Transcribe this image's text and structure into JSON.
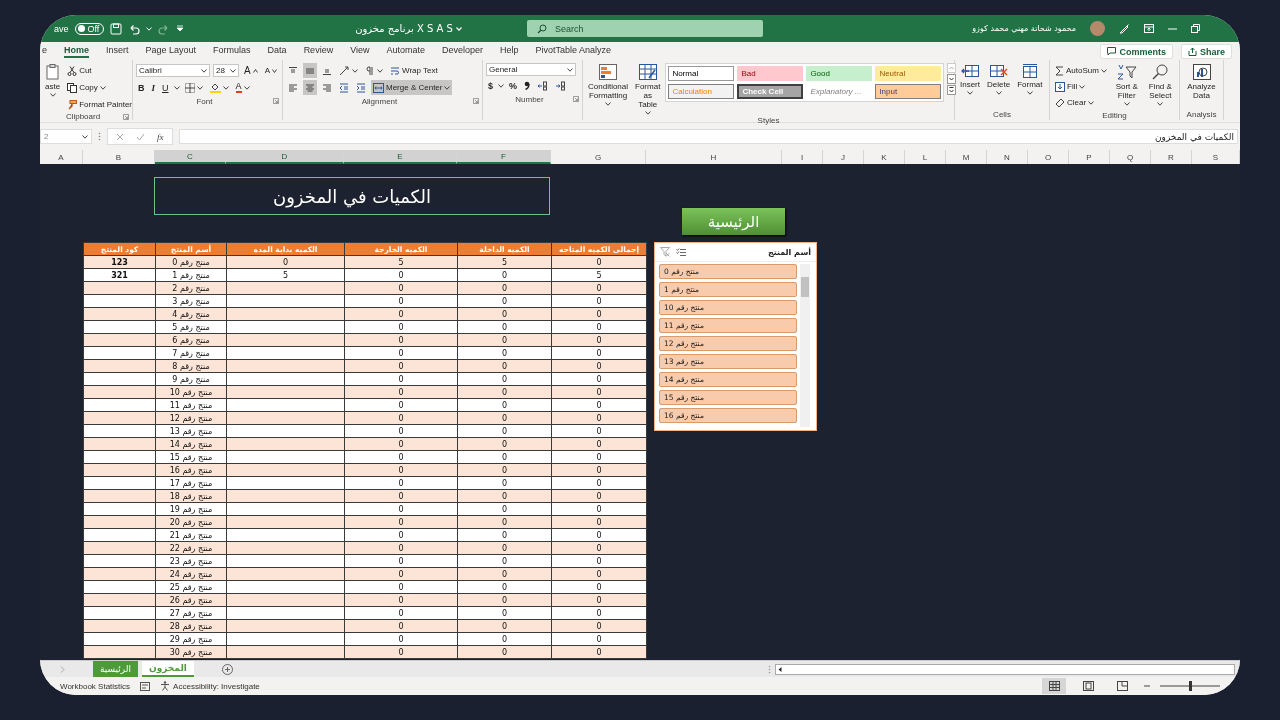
{
  "title_bar": {
    "autosave_label": "ave",
    "autosave": {
      "label": "Off",
      "on": false
    },
    "title": "برنامج مخزون X S A S",
    "search": {
      "placeholder": "Search"
    },
    "user_name": "محمود شحاتة مهني محمد كوزو"
  },
  "ribbon_tabs": [
    {
      "label": "PivotTable Analyze",
      "selected": false
    },
    {
      "label": "Help",
      "selected": false
    },
    {
      "label": "Developer",
      "selected": false
    },
    {
      "label": "Automate",
      "selected": false
    },
    {
      "label": "View",
      "selected": false
    },
    {
      "label": "Review",
      "selected": false
    },
    {
      "label": "Data",
      "selected": false
    },
    {
      "label": "Formulas",
      "selected": false
    },
    {
      "label": "Page Layout",
      "selected": false
    },
    {
      "label": "Insert",
      "selected": false
    },
    {
      "label": "Home",
      "selected": true
    },
    {
      "label": "e",
      "selected": false
    }
  ],
  "ribbon_actions": [
    {
      "kind": "share",
      "label": "Share"
    },
    {
      "kind": "comments",
      "label": "Comments"
    }
  ],
  "ribbon": {
    "clipboard": {
      "label": "Clipboard",
      "paste": "aste",
      "cut": "Cut",
      "copy": "Copy",
      "format_painter": "Format Painter"
    },
    "font": {
      "label": "Font",
      "name": "Calibri",
      "size": "28",
      "grow": "A",
      "shrink": "A",
      "bold": "B",
      "italic": "I",
      "underline": "U",
      "font_color": "A"
    },
    "alignment": {
      "label": "Alignment",
      "vertical": [
        {
          "kind": "top",
          "selected": false
        },
        {
          "kind": "middle",
          "selected": true
        },
        {
          "kind": "bottom",
          "selected": false
        }
      ],
      "horizontal": [
        {
          "kind": "left",
          "selected": false
        },
        {
          "kind": "center",
          "selected": true
        },
        {
          "kind": "right",
          "selected": false
        }
      ],
      "wrap_text": "Wrap Text",
      "merge": {
        "label": "Merge & Center",
        "selected": true
      }
    },
    "number": {
      "label": "Number",
      "format": "General",
      "currency": "$",
      "percent": "%"
    },
    "styles": {
      "label": "Styles",
      "conditional_formatting": "Conditional Formatting",
      "format_as_table": "Format as Table",
      "cell_styles": [
        {
          "kind": "neutral",
          "label": "Neutral"
        },
        {
          "kind": "good",
          "label": "Good"
        },
        {
          "kind": "bad",
          "label": "Bad"
        },
        {
          "kind": "normal",
          "label": "Normal"
        },
        {
          "kind": "input",
          "label": "Input"
        },
        {
          "kind": "explanatory",
          "label": "Explanatory ..."
        },
        {
          "kind": "check",
          "label": "Check Cell"
        },
        {
          "kind": "calculation",
          "label": "Calculation"
        }
      ]
    },
    "cells": {
      "label": "Cells",
      "commands": [
        {
          "kind": "format",
          "label": "Format"
        },
        {
          "kind": "delete",
          "label": "Delete"
        },
        {
          "kind": "insert",
          "label": "Insert"
        }
      ]
    },
    "editing": {
      "label": "Editing",
      "autosum": "AutoSum",
      "fill": "Fill",
      "clear": "Clear",
      "sort_filter": "Sort & Filter",
      "find_select": "Find & Select"
    },
    "analysis": {
      "label": "Analysis",
      "analyze_data": "Analyze Data"
    }
  },
  "formula_bar": {
    "name_box": "2",
    "function_label": "fx",
    "value": "الكميات في المخزون"
  },
  "column_headers": [
    {
      "label": "S",
      "selected": false
    },
    {
      "label": "R",
      "selected": false
    },
    {
      "label": "Q",
      "selected": false
    },
    {
      "label": "P",
      "selected": false
    },
    {
      "label": "O",
      "selected": false
    },
    {
      "label": "N",
      "selected": false
    },
    {
      "label": "M",
      "selected": false
    },
    {
      "label": "L",
      "selected": false
    },
    {
      "label": "K",
      "selected": false
    },
    {
      "label": "J",
      "selected": false
    },
    {
      "label": "I",
      "selected": false
    },
    {
      "label": "H",
      "selected": false
    },
    {
      "label": "G",
      "selected": false
    },
    {
      "label": "F",
      "selected": true
    },
    {
      "label": "E",
      "selected": true
    },
    {
      "label": "D",
      "selected": true
    },
    {
      "label": "C",
      "selected": true
    },
    {
      "label": "B",
      "selected": false
    },
    {
      "label": "A",
      "selected": false
    }
  ],
  "sheet": {
    "title": "الكميات في المخزون",
    "home_button": "الرئيسية",
    "table": {
      "columns": [
        "إجمالى الكميه المتاحه",
        "الكميه الداخلة",
        "الكميه الخارجة",
        "الكميه بداية المده",
        "أسم المنتج",
        "كود المنتج"
      ],
      "rows": [
        [
          "0",
          "5",
          "5",
          "0",
          "منتج رقم 0",
          "123"
        ],
        [
          "5",
          "0",
          "0",
          "5",
          "منتج رقم 1",
          "321"
        ],
        [
          "0",
          "0",
          "0",
          null,
          "منتج رقم 2",
          null
        ],
        [
          "0",
          "0",
          "0",
          null,
          "منتج رقم 3",
          null
        ],
        [
          "0",
          "0",
          "0",
          null,
          "منتج رقم 4",
          null
        ],
        [
          "0",
          "0",
          "0",
          null,
          "منتج رقم 5",
          null
        ],
        [
          "0",
          "0",
          "0",
          null,
          "منتج رقم 6",
          null
        ],
        [
          "0",
          "0",
          "0",
          null,
          "منتج رقم 7",
          null
        ],
        [
          "0",
          "0",
          "0",
          null,
          "منتج رقم 8",
          null
        ],
        [
          "0",
          "0",
          "0",
          null,
          "منتج رقم 9",
          null
        ],
        [
          "0",
          "0",
          "0",
          null,
          "منتج رقم 10",
          null
        ],
        [
          "0",
          "0",
          "0",
          null,
          "منتج رقم 11",
          null
        ],
        [
          "0",
          "0",
          "0",
          null,
          "منتج رقم 12",
          null
        ],
        [
          "0",
          "0",
          "0",
          null,
          "منتج رقم 13",
          null
        ],
        [
          "0",
          "0",
          "0",
          null,
          "منتج رقم 14",
          null
        ],
        [
          "0",
          "0",
          "0",
          null,
          "منتج رقم 15",
          null
        ],
        [
          "0",
          "0",
          "0",
          null,
          "منتج رقم 16",
          null
        ],
        [
          "0",
          "0",
          "0",
          null,
          "منتج رقم 17",
          null
        ],
        [
          "0",
          "0",
          "0",
          null,
          "منتج رقم 18",
          null
        ],
        [
          "0",
          "0",
          "0",
          null,
          "منتج رقم 19",
          null
        ],
        [
          "0",
          "0",
          "0",
          null,
          "منتج رقم 20",
          null
        ],
        [
          "0",
          "0",
          "0",
          null,
          "منتج رقم 21",
          null
        ],
        [
          "0",
          "0",
          "0",
          null,
          "منتج رقم 22",
          null
        ],
        [
          "0",
          "0",
          "0",
          null,
          "منتج رقم 23",
          null
        ],
        [
          "0",
          "0",
          "0",
          null,
          "منتج رقم 24",
          null
        ],
        [
          "0",
          "0",
          "0",
          null,
          "منتج رقم 25",
          null
        ],
        [
          "0",
          "0",
          "0",
          null,
          "منتج رقم 26",
          null
        ],
        [
          "0",
          "0",
          "0",
          null,
          "منتج رقم 27",
          null
        ],
        [
          "0",
          "0",
          "0",
          null,
          "منتج رقم 28",
          null
        ],
        [
          "0",
          "0",
          "0",
          null,
          "منتج رقم 29",
          null
        ],
        [
          "0",
          "0",
          "0",
          null,
          "منتج رقم 30",
          null
        ]
      ]
    }
  },
  "slicer": {
    "title": "أسم المنتج",
    "items": [
      {
        "label": "منتج رقم 0",
        "selected": true
      },
      {
        "label": "منتج رقم 1",
        "selected": true
      },
      {
        "label": "منتج رقم 10",
        "selected": true
      },
      {
        "label": "منتج رقم 11",
        "selected": true
      },
      {
        "label": "منتج رقم 12",
        "selected": true
      },
      {
        "label": "منتج رقم 13",
        "selected": true
      },
      {
        "label": "منتج رقم 14",
        "selected": true
      },
      {
        "label": "منتج رقم 15",
        "selected": true
      },
      {
        "label": "منتج رقم 16",
        "selected": true
      }
    ]
  },
  "sheet_tabs": [
    {
      "label": "المخزون",
      "selected": true,
      "color": "#4e9a3a"
    },
    {
      "label": "الرئيسية",
      "selected": false,
      "color": "#4e9a3a"
    }
  ],
  "status_bar": {
    "items": [
      {
        "kind": "accessibility",
        "label": "Accessibility: Investigate"
      },
      {
        "kind": "statistics",
        "label": "Workbook Statistics"
      }
    ],
    "views": [
      {
        "kind": "normal",
        "selected": true
      },
      {
        "kind": "page_layout",
        "selected": false
      },
      {
        "kind": "page_break",
        "selected": false
      }
    ],
    "zoom": {
      "level": 0.5
    }
  }
}
